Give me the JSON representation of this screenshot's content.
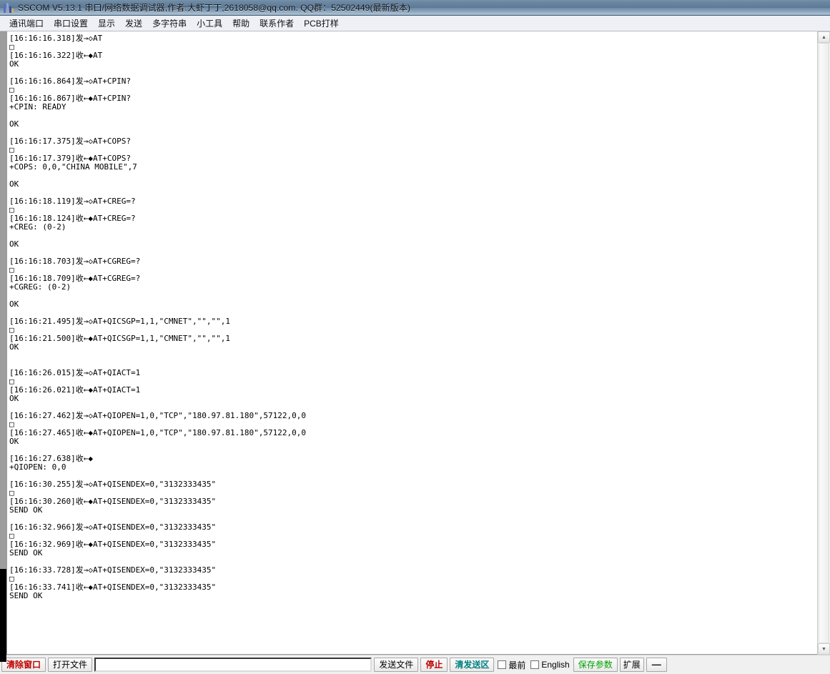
{
  "window": {
    "title": "SSCOM V5.13.1 串口/网络数据调试器,作者:大虾丁丁,2618058@qq.com. QQ群：52502449(最新版本)",
    "icon": "sscom-app-icon"
  },
  "menubar": {
    "items": [
      {
        "label": "通讯端口",
        "name": "menu-comm-port"
      },
      {
        "label": "串口设置",
        "name": "menu-serial-settings"
      },
      {
        "label": "显示",
        "name": "menu-display"
      },
      {
        "label": "发送",
        "name": "menu-send"
      },
      {
        "label": "多字符串",
        "name": "menu-multi-string"
      },
      {
        "label": "小工具",
        "name": "menu-tools"
      },
      {
        "label": "帮助",
        "name": "menu-help"
      },
      {
        "label": "联系作者",
        "name": "menu-contact-author"
      },
      {
        "label": "PCB打样",
        "name": "menu-pcb-proofing"
      }
    ]
  },
  "log": {
    "lines": [
      "[16:16:16.318]发→◇AT",
      "□",
      "[16:16:16.322]收←◆AT",
      "OK",
      "",
      "[16:16:16.864]发→◇AT+CPIN?",
      "□",
      "[16:16:16.867]收←◆AT+CPIN?",
      "+CPIN: READY",
      "",
      "OK",
      "",
      "[16:16:17.375]发→◇AT+COPS?",
      "□",
      "[16:16:17.379]收←◆AT+COPS?",
      "+COPS: 0,0,\"CHINA MOBILE\",7",
      "",
      "OK",
      "",
      "[16:16:18.119]发→◇AT+CREG=?",
      "□",
      "[16:16:18.124]收←◆AT+CREG=?",
      "+CREG: (0-2)",
      "",
      "OK",
      "",
      "[16:16:18.703]发→◇AT+CGREG=?",
      "□",
      "[16:16:18.709]收←◆AT+CGREG=?",
      "+CGREG: (0-2)",
      "",
      "OK",
      "",
      "[16:16:21.495]发→◇AT+QICSGP=1,1,\"CMNET\",\"\",\"\",1",
      "□",
      "[16:16:21.500]收←◆AT+QICSGP=1,1,\"CMNET\",\"\",\"\",1",
      "OK",
      "",
      "",
      "[16:16:26.015]发→◇AT+QIACT=1",
      "□",
      "[16:16:26.021]收←◆AT+QIACT=1",
      "OK",
      "",
      "[16:16:27.462]发→◇AT+QIOPEN=1,0,\"TCP\",\"180.97.81.180\",57122,0,0",
      "□",
      "[16:16:27.465]收←◆AT+QIOPEN=1,0,\"TCP\",\"180.97.81.180\",57122,0,0",
      "OK",
      "",
      "[16:16:27.638]收←◆",
      "+QIOPEN: 0,0",
      "",
      "[16:16:30.255]发→◇AT+QISENDEX=0,\"3132333435\"",
      "□",
      "[16:16:30.260]收←◆AT+QISENDEX=0,\"3132333435\"",
      "SEND OK",
      "",
      "[16:16:32.966]发→◇AT+QISENDEX=0,\"3132333435\"",
      "□",
      "[16:16:32.969]收←◆AT+QISENDEX=0,\"3132333435\"",
      "SEND OK",
      "",
      "[16:16:33.728]发→◇AT+QISENDEX=0,\"3132333435\"",
      "□",
      "[16:16:33.741]收←◆AT+QISENDEX=0,\"3132333435\"",
      "SEND OK"
    ]
  },
  "scrollbar": {
    "up_arrow": "▲",
    "down_arrow": "▼"
  },
  "bottombar": {
    "clear_window": "清除窗口",
    "open_file": "打开文件",
    "send_input_value": "",
    "send_input_placeholder": "",
    "send_file": "发送文件",
    "stop": "停止",
    "clear_send_area": "清发送区",
    "topmost_label": "最前",
    "english_label": "English",
    "save_params": "保存参数",
    "extend": "扩展",
    "minimize": "—"
  },
  "colors": {
    "accent_red": "#c00000",
    "accent_teal": "#008080",
    "accent_green": "#00a000",
    "title_blue": "#5f7d99"
  }
}
